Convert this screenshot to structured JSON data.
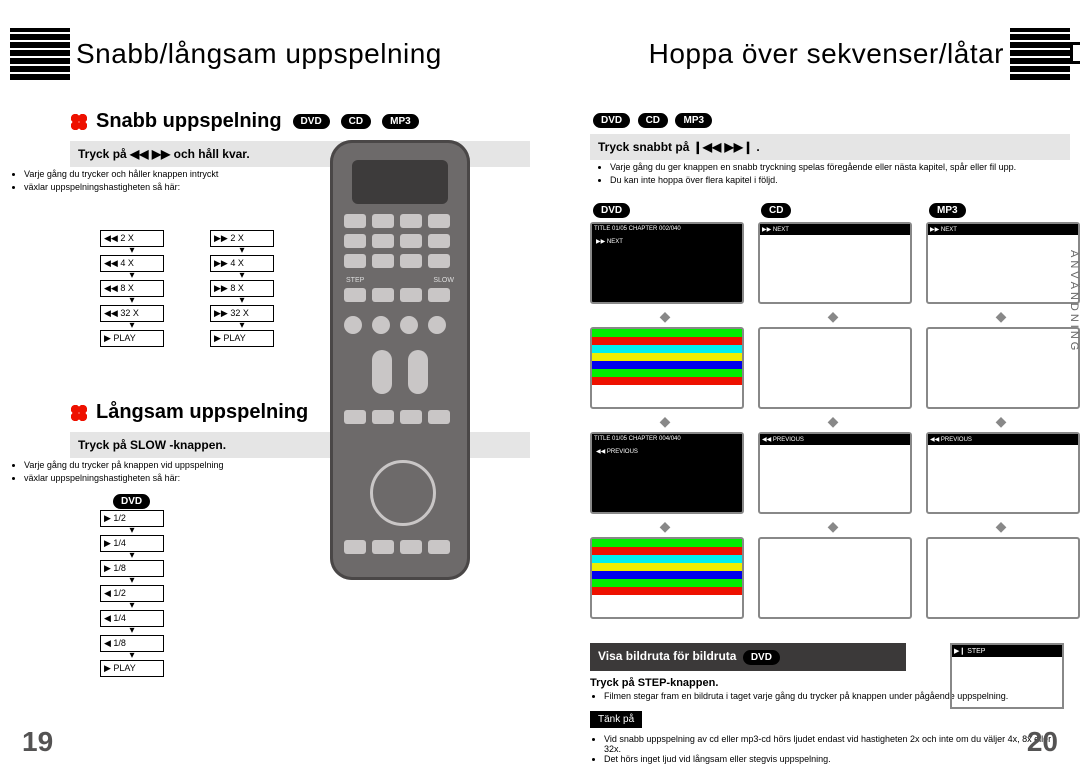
{
  "left": {
    "title": "Snabb/långsam uppspelning",
    "section1": {
      "heading": "Snabb uppspelning",
      "badges": [
        "DVD",
        "CD",
        "MP3"
      ],
      "band": "Tryck på ◀◀ ▶▶ och håll kvar.",
      "notes": [
        "Varje gång du trycker och håller knappen intryckt",
        "växlar uppspelningshastigheten så här:"
      ],
      "speeds_rev": [
        "◀◀  2 X",
        "◀◀  4 X",
        "◀◀  8 X",
        "◀◀  32 X",
        "▶  PLAY"
      ],
      "speeds_fwd": [
        "▶▶  2 X",
        "▶▶  4 X",
        "▶▶  8 X",
        "▶▶  32 X",
        "▶  PLAY"
      ]
    },
    "section2": {
      "heading": "Långsam uppspelning",
      "band": "Tryck på SLOW -knappen.",
      "notes": [
        "Varje gång du trycker på knappen vid uppspelning",
        "växlar uppspelningshastigheten så här:"
      ],
      "badge": "DVD",
      "speeds": [
        "▶  1/2",
        "▶  1/4",
        "▶  1/8",
        "◀  1/2",
        "◀  1/4",
        "◀  1/8",
        "▶  PLAY"
      ]
    },
    "page_num": "19",
    "remote": {
      "slow_label": "SLOW",
      "step_label": "STEP"
    }
  },
  "right": {
    "title": "Hoppa över sekvenser/låtar",
    "top_badges": [
      "DVD",
      "CD",
      "MP3"
    ],
    "band": "Tryck snabbt på  ❙◀◀ ▶▶❙ .",
    "notes": [
      "Varje gång du ger knappen en snabb tryckning spelas föregående eller nästa kapitel, spår eller fil upp.",
      "Du kan inte hoppa över flera kapitel i följd."
    ],
    "columns": {
      "dvd": {
        "label": "DVD",
        "rows": [
          "TITLE 01/05 CHAPTER 002/040",
          "▶▶ NEXT",
          "",
          "TITLE 01/05 CHAPTER 004/040",
          "◀◀ PREVIOUS",
          ""
        ]
      },
      "cd": {
        "label": "CD",
        "rows": [
          "",
          "▶▶ NEXT",
          "",
          "",
          "◀◀ PREVIOUS",
          ""
        ]
      },
      "mp3": {
        "label": "MP3",
        "rows": [
          "",
          "▶▶ NEXT",
          "",
          "",
          "◀◀ PREVIOUS",
          ""
        ]
      }
    },
    "bottom": {
      "head": "Visa bildruta för bildruta",
      "head_badge": "DVD",
      "sub": "Tryck på STEP-knappen.",
      "note1": "Filmen stegar fram en bildruta i taget varje gång du",
      "note2": "trycker på knappen under pågående uppspelning.",
      "tank": "Tänk på",
      "foot1": "Vid snabb uppspelning av cd eller mp3-cd hörs ljudet endast vid hastigheten 2x och inte om du väljer 4x, 8x eller 32x.",
      "foot2": "Det hörs inget ljud vid långsam eller stegvis uppspelning.",
      "step_screen": "▶❙ STEP"
    },
    "side_tab": "ANVÄNDNING",
    "page_num": "20"
  }
}
